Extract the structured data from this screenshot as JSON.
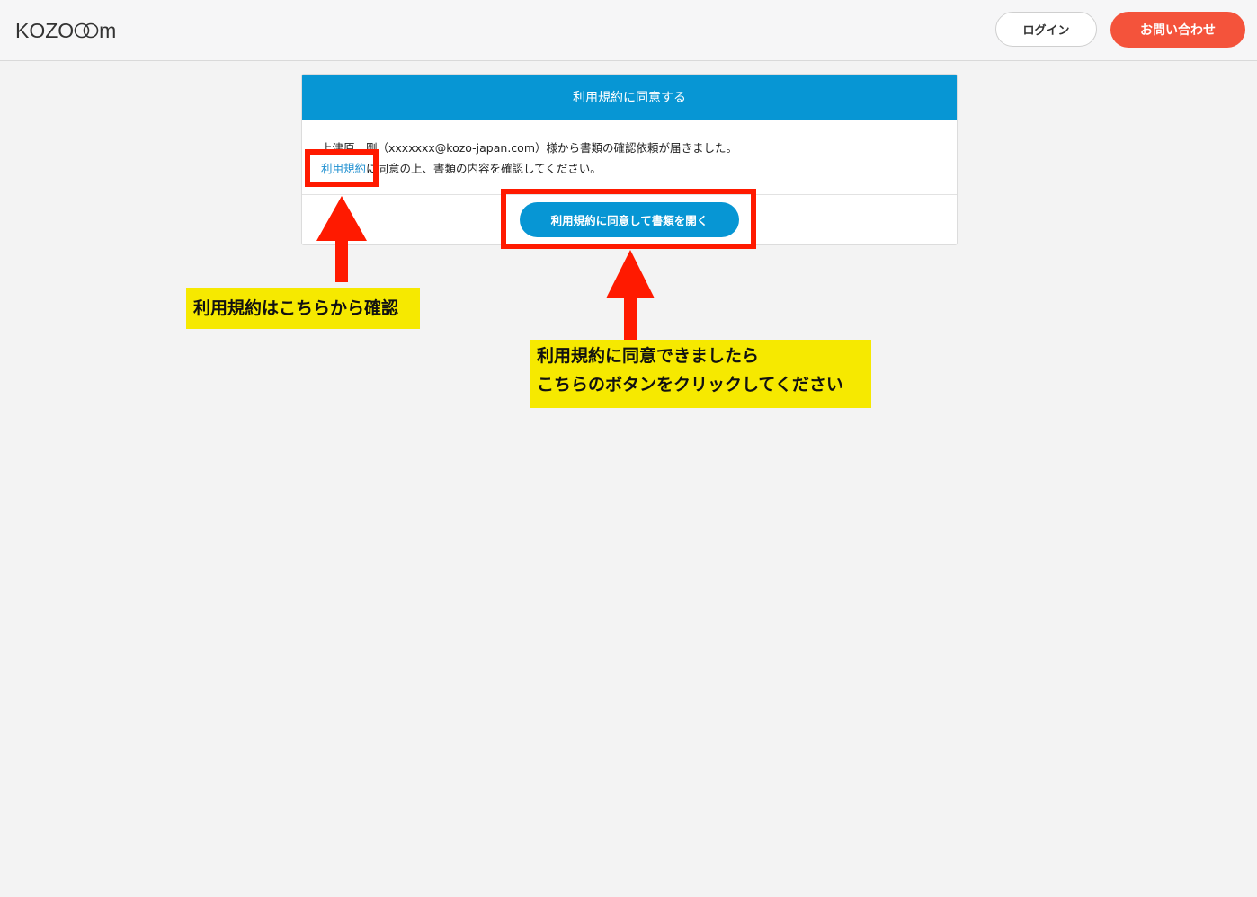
{
  "header": {
    "logo_text": "KOZO",
    "logo_suffix": "m",
    "login_label": "ログイン",
    "contact_label": "お問い合わせ"
  },
  "card": {
    "title": "利用規約に同意する",
    "line1": "上津原　剛（xxxxxxx@kozo-japan.com）様から書類の確認依頼が届きました。",
    "terms_link_label": "利用規約",
    "line2_rest": "に同意の上、書類の内容を確認してください。",
    "open_button_label": "利用規約に同意して書類を開く"
  },
  "annotations": {
    "note1": "利用規約はこちらから確認",
    "note2_line1": "利用規約に同意できましたら",
    "note2_line2": "こちらのボタンをクリックしてください",
    "highlight_color": "#ff1a00",
    "note_color": "#f6e900"
  },
  "colors": {
    "accent_blue": "#0796d4",
    "contact_red": "#f4533b"
  }
}
